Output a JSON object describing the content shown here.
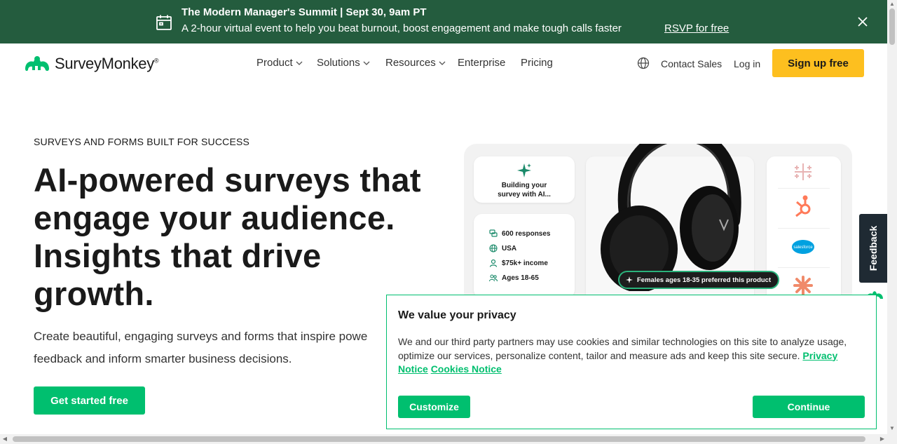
{
  "banner": {
    "title": "The Modern Manager's Summit | Sept 30, 9am PT",
    "subtitle": "A 2-hour virtual event to help you beat burnout, boost engagement and make tough calls faster",
    "rsvp": "RSVP for free"
  },
  "nav": {
    "logo": "SurveyMonkey",
    "items": [
      "Product",
      "Solutions",
      "Resources",
      "Enterprise",
      "Pricing"
    ],
    "contact": "Contact Sales",
    "login": "Log in",
    "signup": "Sign up free"
  },
  "hero": {
    "eyebrow": "SURVEYS AND FORMS BUILT FOR SUCCESS",
    "headline_lines": [
      "AI-powered surveys that",
      "engage your audience.",
      "Insights that drive",
      "growth."
    ],
    "sub_lines": [
      "Create beautiful, engaging surveys and forms that inspire powe",
      "feedback and inform smarter business decisions."
    ],
    "cta": "Get started free"
  },
  "visual": {
    "building_lines": [
      "Building your",
      "survey with AI..."
    ],
    "stats": [
      "600 responses",
      "USA",
      "$75k+ income",
      "Ages 18-65"
    ],
    "pill": "Females ages 18-35 preferred this product",
    "salesforce_label": "salesforce"
  },
  "feedback": "Feedback",
  "cookie": {
    "title": "We value your privacy",
    "body": "We and our third party partners may use cookies and similar technologies on this site to analyze usage, optimize our services, personalize content, tailor and measure ads and keep this site secure.",
    "privacy_link": "Privacy Notice",
    "cookies_link": "Cookies Notice",
    "customize": "Customize",
    "continue": "Continue"
  },
  "colors": {
    "banner": "#245c3e",
    "brand_green": "#00bf6f",
    "signup_yellow": "#fdbf1f",
    "feedback_tab": "#1f2a33"
  }
}
